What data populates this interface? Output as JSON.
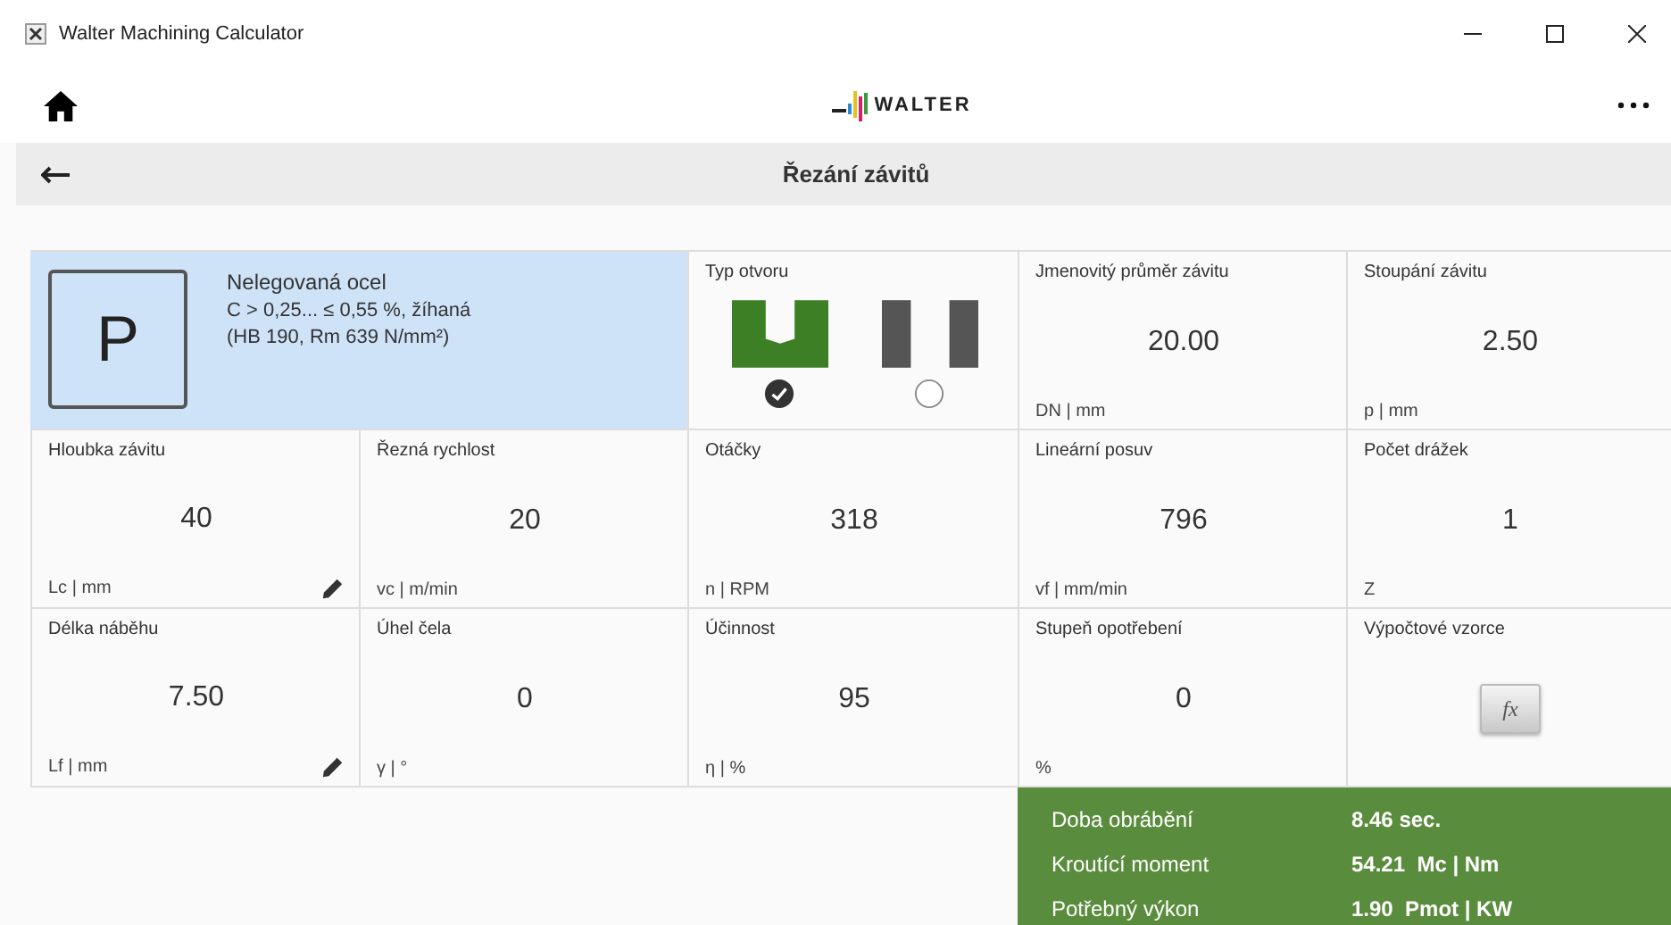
{
  "window": {
    "title": "Walter Machining Calculator"
  },
  "header": {
    "logo": "WALTER"
  },
  "subheader": {
    "title": "Řezání závitů"
  },
  "material": {
    "code": "P",
    "lines": [
      "Nelegovaná ocel",
      "C > 0,25... ≤ 0,55 %, žíhaná",
      "(HB 190, Rm 639 N/mm²)"
    ]
  },
  "hole_type": {
    "label": "Typ otvoru",
    "options": [
      {
        "kind": "blind",
        "selected": true
      },
      {
        "kind": "through",
        "selected": false
      }
    ]
  },
  "cells": [
    {
      "kind": "value",
      "label": "Jmenovitý průměr závitu",
      "value": "20.00",
      "unit": "DN | mm",
      "editable": false
    },
    {
      "kind": "value",
      "label": "Stoupání závitu",
      "value": "2.50",
      "unit": "p | mm",
      "editable": false
    },
    {
      "kind": "value",
      "label": "Hloubka závitu",
      "value": "40",
      "unit": "Lc | mm",
      "editable": true
    },
    {
      "kind": "value",
      "label": "Řezná rychlost",
      "value": "20",
      "unit": "vc | m/min",
      "editable": false
    },
    {
      "kind": "value",
      "label": "Otáčky",
      "value": "318",
      "unit": "n | RPM",
      "editable": false
    },
    {
      "kind": "value",
      "label": "Lineární posuv",
      "value": "796",
      "unit": "vf | mm/min",
      "editable": false
    },
    {
      "kind": "value",
      "label": "Počet drážek",
      "value": "1",
      "unit": "Z",
      "editable": false
    },
    {
      "kind": "value",
      "label": "Délka náběhu",
      "value": "7.50",
      "unit": "Lf | mm",
      "editable": true
    },
    {
      "kind": "value",
      "label": "Úhel čela",
      "value": "0",
      "unit": "γ | °",
      "editable": false
    },
    {
      "kind": "value",
      "label": "Účinnost",
      "value": "95",
      "unit": "η | %",
      "editable": false
    },
    {
      "kind": "value",
      "label": "Stupeň opotřebení",
      "value": "0",
      "unit": "%",
      "editable": false
    },
    {
      "kind": "formula",
      "label": "Výpočtové vzorce",
      "button": "fx"
    }
  ],
  "results": [
    {
      "label": "Doba obrábění",
      "value": "8.46 sec."
    },
    {
      "label": "Kroutící moment",
      "value": "54.21  Mc | Nm"
    },
    {
      "label": "Potřebný výkon",
      "value": "1.90  Pmot | KW"
    }
  ]
}
